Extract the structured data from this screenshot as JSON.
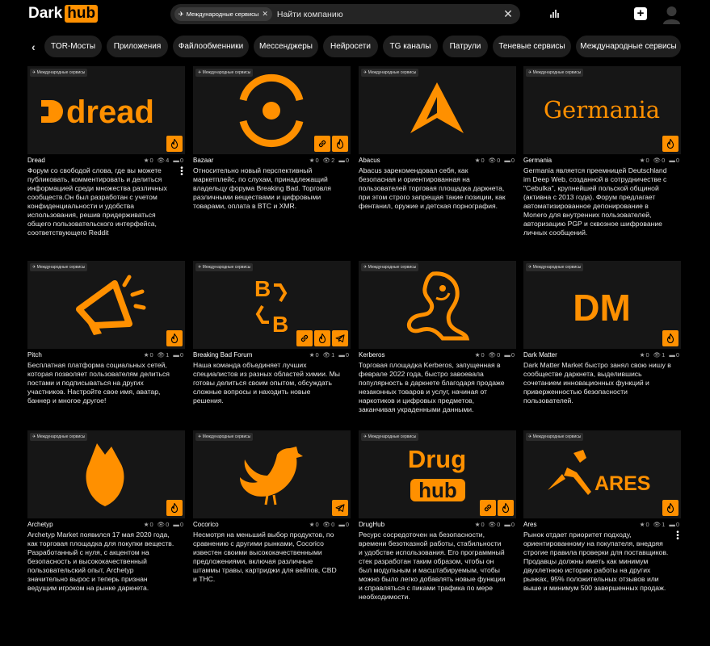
{
  "header": {
    "logo_dark": "Dark",
    "logo_hub": "hub",
    "chip_label": "Международные сервисы",
    "search_placeholder": "Найти компанию"
  },
  "categories": [
    "TOR-Мосты",
    "Приложения",
    "Файлообменники",
    "Мессенджеры",
    "Нейросети",
    "TG каналы",
    "Патрули",
    "Теневые сервисы",
    "Международные сервисы"
  ],
  "tag_label": "Международные сервисы",
  "colors": {
    "accent": "#ff9000",
    "card_bg": "#161616",
    "chip_bg": "#1f1f1f"
  },
  "cards": [
    {
      "name": "Dread",
      "stars": "0",
      "views": "4",
      "comments": "0",
      "badges": [
        "fire-icon"
      ],
      "desc": "Форум со свободой слова, где вы можете публиковать, комментировать и делиться информацией среди множества различных сообществ.Он был разработан с учетом конфиденциальности и удобства использования, решив придерживаться общего пользовательского интерфейса, соответствующего Reddit"
    },
    {
      "name": "Bazaar",
      "stars": "0",
      "views": "2",
      "comments": "0",
      "badges": [
        "link-icon",
        "fire-icon"
      ],
      "desc": "Относительно новый перспективный маркетплейс, по слухам, принадлежащий владельцу форума Breaking Bad. Торговля различными веществами и цифровыми товарами, оплата в BTC и XMR."
    },
    {
      "name": "Abacus",
      "stars": "0",
      "views": "0",
      "comments": "0",
      "badges": [],
      "desc": "Abacus зарекомендовал себя, как безопасная и ориентированная на пользователей торговая площадка даркнета, при этом строго запрещая такие позиции, как фентанил, оружие и детская порнография."
    },
    {
      "name": "Germania",
      "stars": "0",
      "views": "0",
      "comments": "0",
      "badges": [
        "fire-icon"
      ],
      "desc": "Germania является преемницей Deutschland im Deep Web, созданной в сотрудничестве с \"Cebulka\", крупнейшей польской общиной (активна с 2013 года). Форум предлагает автоматизированное депонирование в Monero для внутренних пользователей, авторизацию PGP и сквозное шифрование личных сообщений."
    },
    {
      "name": "Pitch",
      "stars": "0",
      "views": "1",
      "comments": "0",
      "badges": [
        "fire-icon"
      ],
      "desc": "Бесплатная платформа социальных сетей, которая позволяет пользователям делиться постами и подписываться на других участников. Настройте свое имя, аватар, баннер и многое другое!"
    },
    {
      "name": "Breaking Bad Forum",
      "stars": "0",
      "views": "1",
      "comments": "0",
      "badges": [
        "link-icon",
        "fire-icon",
        "telegram-icon"
      ],
      "desc": "Наша команда объединяет лучших специалистов из разных областей химии. Мы готовы делиться своим опытом, обсуждать сложные вопросы и находить новые решения."
    },
    {
      "name": "Kerberos",
      "stars": "0",
      "views": "0",
      "comments": "0",
      "badges": [],
      "desc": "Торговая площадка Kerberos, запущенная в феврале 2022 года, быстро завоевала популярность в даркнете благодаря продаже незаконных товаров и услуг, начиная от наркотиков и цифровых предметов, заканчивая украденными данными."
    },
    {
      "name": "Dark Matter",
      "stars": "0",
      "views": "1",
      "comments": "0",
      "badges": [
        "fire-icon"
      ],
      "desc": "Dark Matter Market быстро занял свою нишу в сообществе даркнета, выделившись сочетанием инновационных функций и приверженностью безопасности пользователей."
    },
    {
      "name": "Archetyp",
      "stars": "0",
      "views": "0",
      "comments": "0",
      "badges": [
        "fire-icon"
      ],
      "desc": "Archetyp Market появился 17 мая 2020 года, как торговая площадка для покупки веществ. Разработанный с нуля, с акцентом на безопасность и высококачественный пользовательский опыт, Archetyp значительно вырос и теперь признан ведущим игроком на рынке даркнета."
    },
    {
      "name": "Cocorico",
      "stars": "0",
      "views": "0",
      "comments": "0",
      "badges": [
        "telegram-icon"
      ],
      "desc": "Несмотря на меньший выбор продуктов, по сравнению с другими рынками, Cocorico известен своими высококачественными предложениями, включая различные штаммы травы, картриджи для вейпов, CBD и THC."
    },
    {
      "name": "DrugHub",
      "stars": "0",
      "views": "0",
      "comments": "0",
      "badges": [
        "link-icon",
        "fire-icon"
      ],
      "desc": "Ресурс сосредоточен на безопасности, времени безотказной работы, стабильности и удобстве использования. Его программный стек разработан таким образом, чтобы он был модульным и масштабируемым, чтобы можно было легко добавлять новые функции и справляться с пиками трафика по мере необходимости."
    },
    {
      "name": "Ares",
      "stars": "0",
      "views": "1",
      "comments": "0",
      "badges": [
        "fire-icon"
      ],
      "desc": "Рынок отдает приоритет подходу, ориентированному на покупателя, внедряя строгие правила проверки для поставщиков. Продавцы должны иметь как минимум двухлетнюю историю работы на других рынках, 95% положительных отзывов или выше и минимум 500 завершенных продаж."
    }
  ],
  "logos": {
    "dread": "dread",
    "germania": "Germania",
    "dm": "DM",
    "drug": "Drug",
    "hub": "hub",
    "ares": "ARES"
  }
}
